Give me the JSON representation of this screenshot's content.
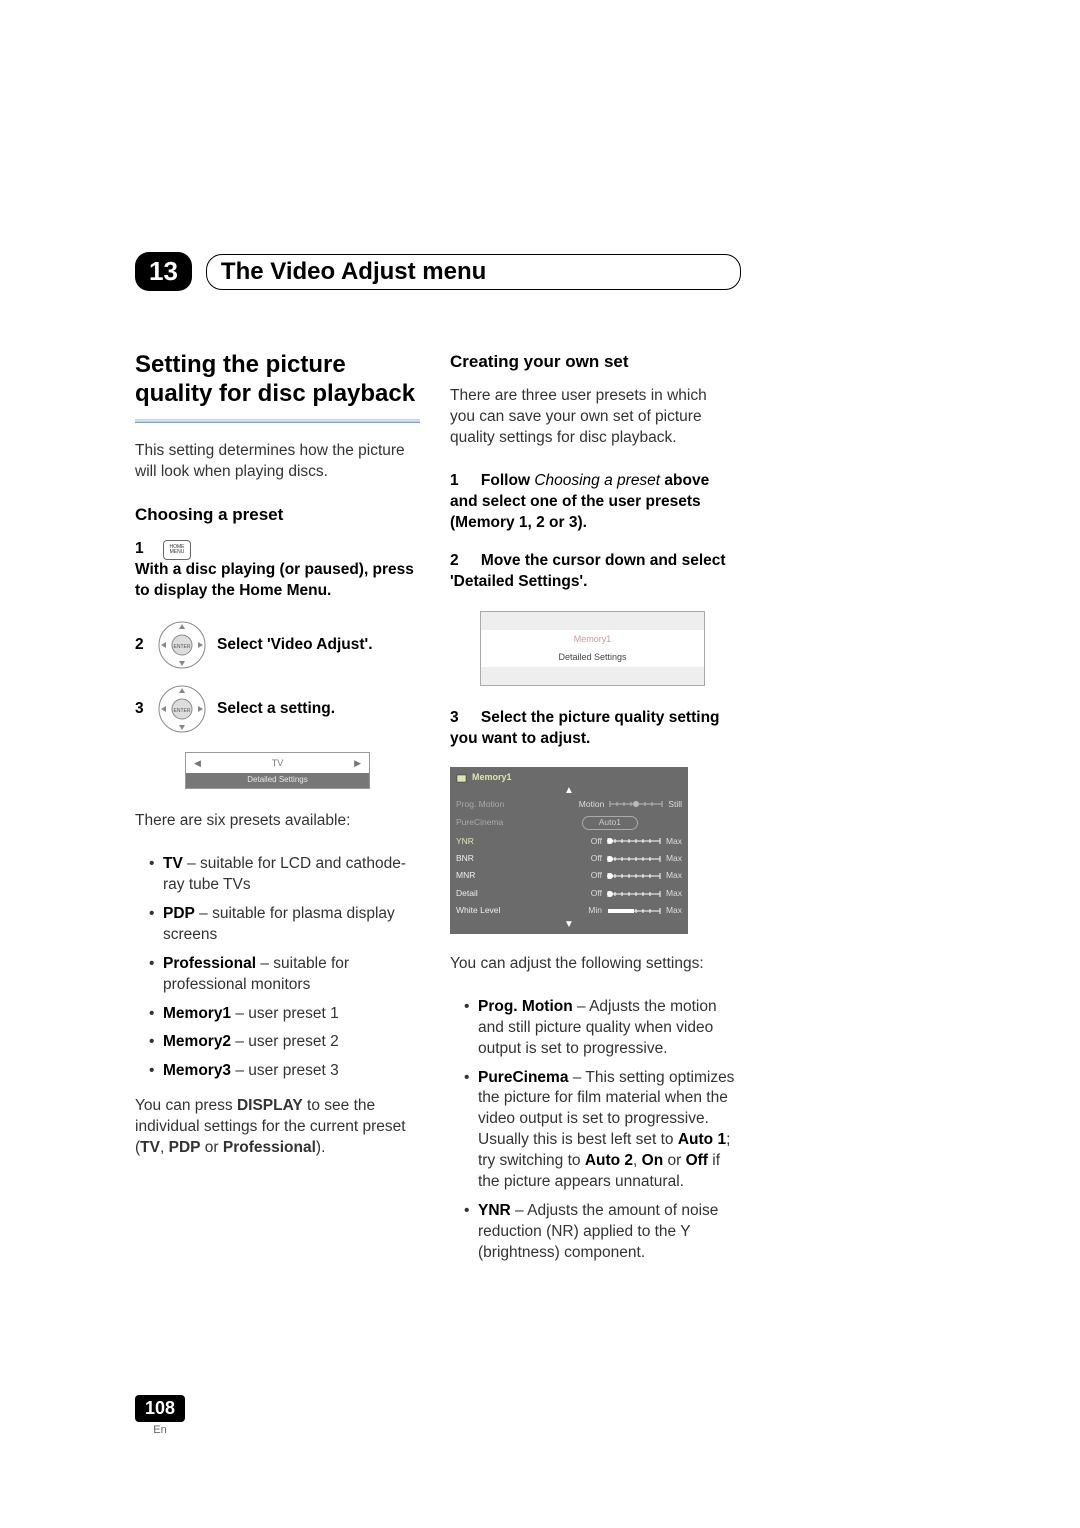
{
  "chapter": {
    "number": "13",
    "title": "The Video Adjust menu"
  },
  "left": {
    "h1": "Setting the picture quality for disc playback",
    "intro": "This setting determines how the picture will look when playing discs.",
    "h2": "Choosing a preset",
    "home_label_top": "HOME",
    "home_label_bottom": "MENU",
    "step1_num": "1",
    "step1_text": "With a disc playing (or paused), press to display the Home Menu.",
    "step2_num": "2",
    "step2_text": "Select 'Video Adjust'.",
    "step3_num": "3",
    "step3_text": "Select a setting.",
    "panel1": {
      "left_tri": "◀",
      "label": "TV",
      "right_tri": "▶",
      "footer": "Detailed Settings"
    },
    "presets_intro": "There are six presets available:",
    "presets": [
      {
        "name": "TV",
        "desc": " – suitable for LCD and cathode-ray tube TVs"
      },
      {
        "name": "PDP",
        "desc": " – suitable for plasma display screens"
      },
      {
        "name": "Professional",
        "desc": " – suitable for professional monitors"
      },
      {
        "name": "Memory1",
        "desc": " – user preset 1"
      },
      {
        "name": "Memory2",
        "desc": " – user preset 2"
      },
      {
        "name": "Memory3",
        "desc": " – user preset 3"
      }
    ],
    "display_note_pre": "You can press ",
    "display_note_bold": "DISPLAY",
    "display_note_mid": " to see the individual settings for the current preset (",
    "display_note_tv": "TV",
    "display_note_c1": ", ",
    "display_note_pdp": "PDP",
    "display_note_c2": " or ",
    "display_note_pro": "Professional",
    "display_note_end": ")."
  },
  "right": {
    "h2": "Creating your own set",
    "intro": "There are three user presets in which you can save your own set of picture quality settings for disc playback.",
    "step1_num": "1",
    "step1_a": "Follow ",
    "step1_i": "Choosing a preset",
    "step1_b": " above and select one of the user presets (Memory 1, 2 or 3).",
    "step2_num": "2",
    "step2_text": "Move the cursor down and select 'Detailed Settings'.",
    "panel2": {
      "memory": "Memory1",
      "detailed": "Detailed Settings"
    },
    "step3_num": "3",
    "step3_text": "Select the picture quality setting you want to adjust.",
    "panel3": {
      "title": "Memory1",
      "arrow_up": "▲",
      "arrow_down": "▼",
      "rows": [
        {
          "name": "Prog. Motion",
          "left": "Motion",
          "right": "Still",
          "type": "slider_center"
        },
        {
          "name": "PureCinema",
          "center": "Auto1",
          "type": "pill"
        },
        {
          "name": "YNR",
          "left": "Off",
          "right": "Max",
          "type": "slider_left"
        },
        {
          "name": "BNR",
          "left": "Off",
          "right": "Max",
          "type": "slider_left"
        },
        {
          "name": "MNR",
          "left": "Off",
          "right": "Max",
          "type": "slider_left"
        },
        {
          "name": "Detail",
          "left": "Off",
          "right": "Max",
          "type": "slider_left"
        },
        {
          "name": "White Level",
          "left": "Min",
          "right": "Max",
          "type": "slider_fill"
        }
      ]
    },
    "adjust_intro": "You can adjust the following settings:",
    "settings": [
      {
        "name": "Prog. Motion",
        "desc": " – Adjusts the motion and still picture quality when video output is set to progressive."
      },
      {
        "name": "PureCinema",
        "desc_pre": " – This setting optimizes the picture for film material when the video output is set to progressive. Usually this is best left set to ",
        "b1": "Auto 1",
        "m1": "; try switching to ",
        "b2": "Auto 2",
        "m2": ", ",
        "b3": "On",
        "m3": " or ",
        "b4": "Off",
        "desc_post": " if the picture appears unnatural."
      },
      {
        "name": "YNR",
        "desc": " – Adjusts the amount of noise reduction (NR) applied to the Y (brightness) component."
      }
    ]
  },
  "page": {
    "number": "108",
    "lang": "En"
  }
}
